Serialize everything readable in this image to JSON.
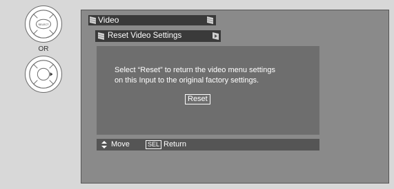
{
  "remote": {
    "select_button_label": "SELECT",
    "or_label": "OR"
  },
  "menu": {
    "title": "Video",
    "submenu_title": "Reset Video Settings"
  },
  "dialog": {
    "message_line1": "Select “Reset” to return the video menu settings",
    "message_line2": "on this Input to the original factory settings.",
    "reset_button_label": "Reset"
  },
  "help_bar": {
    "move_label": "Move",
    "sel_key_label": "SEL",
    "return_label": "Return"
  },
  "icons": {
    "select": "select-button-icon",
    "right_arrow": "right-arrow-dpad-icon",
    "flag": "flag-icon",
    "updown": "up-down-arrow-icon"
  },
  "colors": {
    "background": "#d8d8d8",
    "screen": "#8a8a8a",
    "menu_bar": "#3a3a3a",
    "dialog": "#6e6e6e",
    "help_bar": "#555555",
    "text": "#ffffff"
  }
}
